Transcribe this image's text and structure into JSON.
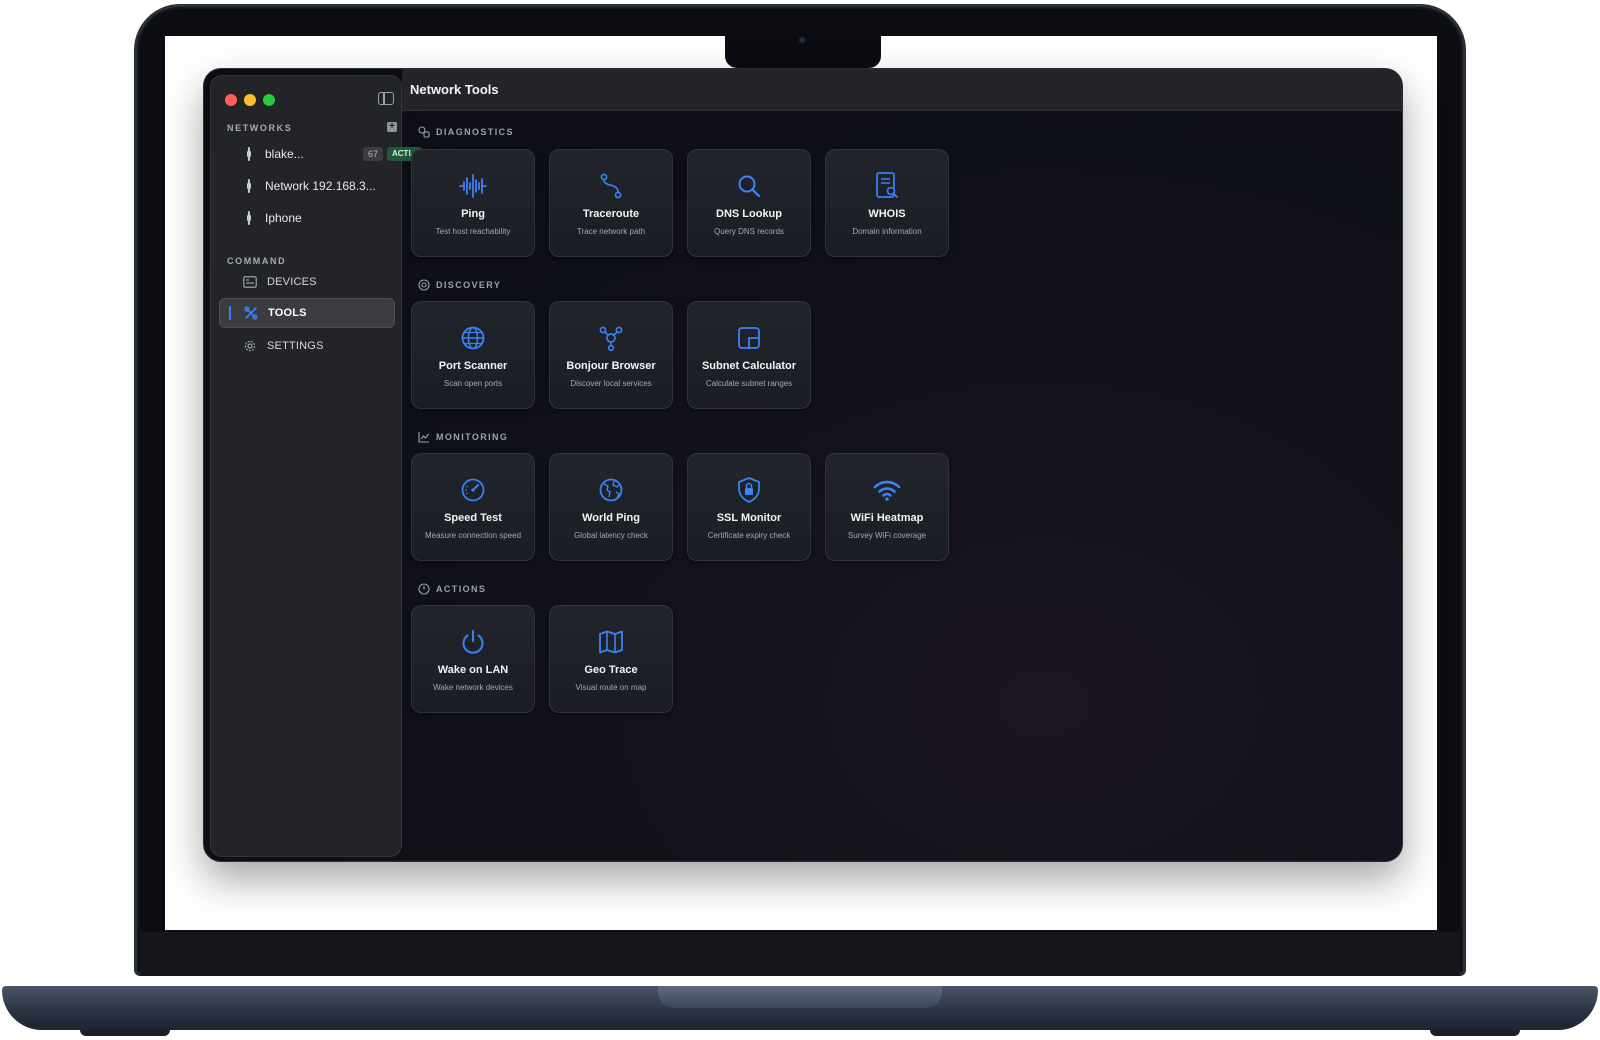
{
  "window": {
    "title": "Network Tools"
  },
  "sidebar": {
    "networks_label": "NETWORKS",
    "add_label": "+",
    "networks": [
      {
        "name": "blake...",
        "count": "67",
        "badge": "ACTI..."
      },
      {
        "name": "Network 192.168.3..."
      },
      {
        "name": "Iphone"
      }
    ],
    "command_label": "COMMAND",
    "nav": [
      {
        "label": "DEVICES",
        "icon": "devices-icon"
      },
      {
        "label": "TOOLS",
        "icon": "tools-icon",
        "active": true
      },
      {
        "label": "SETTINGS",
        "icon": "gear-icon"
      }
    ]
  },
  "groups": [
    {
      "label": "DIAGNOSTICS",
      "icon": "diagnostics-icon",
      "tools": [
        {
          "title": "Ping",
          "subtitle": "Test host reachability",
          "icon": "waveform-icon"
        },
        {
          "title": "Traceroute",
          "subtitle": "Trace network path",
          "icon": "path-icon"
        },
        {
          "title": "DNS Lookup",
          "subtitle": "Query DNS records",
          "icon": "search-icon"
        },
        {
          "title": "WHOIS",
          "subtitle": "Domain information",
          "icon": "document-search-icon"
        }
      ]
    },
    {
      "label": "DISCOVERY",
      "icon": "discovery-icon",
      "tools": [
        {
          "title": "Port Scanner",
          "subtitle": "Scan open ports",
          "icon": "globe-icon"
        },
        {
          "title": "Bonjour Browser",
          "subtitle": "Discover local services",
          "icon": "services-icon"
        },
        {
          "title": "Subnet Calculator",
          "subtitle": "Calculate subnet ranges",
          "icon": "subnet-icon"
        }
      ]
    },
    {
      "label": "MONITORING",
      "icon": "chart-icon",
      "tools": [
        {
          "title": "Speed Test",
          "subtitle": "Measure connection speed",
          "icon": "gauge-icon"
        },
        {
          "title": "World Ping",
          "subtitle": "Global latency check",
          "icon": "world-icon"
        },
        {
          "title": "SSL Monitor",
          "subtitle": "Certificate expiry check",
          "icon": "lock-shield-icon"
        },
        {
          "title": "WiFi Heatmap",
          "subtitle": "Survey WiFi coverage",
          "icon": "wifi-icon"
        }
      ]
    },
    {
      "label": "ACTIONS",
      "icon": "actions-icon",
      "tools": [
        {
          "title": "Wake on LAN",
          "subtitle": "Wake network devices",
          "icon": "power-icon"
        },
        {
          "title": "Geo Trace",
          "subtitle": "Visual route on map",
          "icon": "map-icon"
        }
      ]
    }
  ],
  "colors": {
    "accent": "#3b82f6",
    "background": "#0f1018",
    "sidebar": "#232428",
    "card": "#21232a",
    "badge": "#1f5b3b"
  }
}
